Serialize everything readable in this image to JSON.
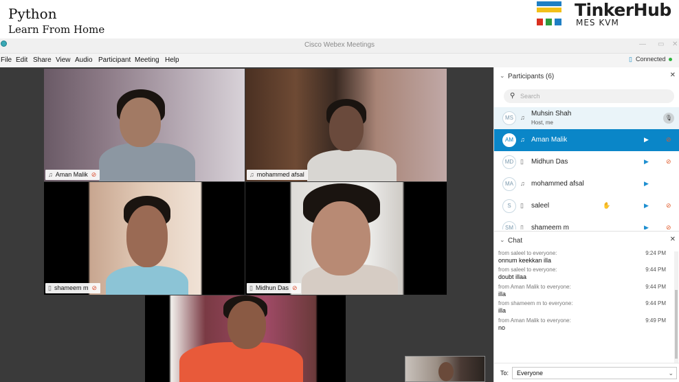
{
  "overlay": {
    "course_title": "Python",
    "course_subtitle": "Learn From Home",
    "brand_name": "TinkerHub",
    "brand_sub": "MES KVM"
  },
  "window": {
    "title": "Cisco Webex Meetings",
    "status": "Connected"
  },
  "menu": [
    "File",
    "Edit",
    "Share",
    "View",
    "Audio",
    "Participant",
    "Meeting",
    "Help"
  ],
  "videos": [
    {
      "name": "Aman Malik",
      "muted": true
    },
    {
      "name": "mohammed afsal",
      "muted": false
    },
    {
      "name": "shameem m",
      "muted": true
    },
    {
      "name": "Midhun Das",
      "muted": true
    }
  ],
  "participants": {
    "header": "Participants (6)",
    "search_placeholder": "Search",
    "list": [
      {
        "initials": "MS",
        "name": "Muhsin Shah",
        "subtitle": "Host, me"
      },
      {
        "initials": "AM",
        "name": "Aman Malik"
      },
      {
        "initials": "MD",
        "name": "Midhun Das"
      },
      {
        "initials": "MA",
        "name": "mohammed afsal"
      },
      {
        "initials": "S",
        "name": "saleel"
      },
      {
        "initials": "SM",
        "name": "shameem m"
      }
    ]
  },
  "chat": {
    "header": "Chat",
    "messages": [
      {
        "from": "from saleel to everyone:",
        "time": "9:24 PM",
        "text": "onnum keekkan illa"
      },
      {
        "from": "from saleel to everyone:",
        "time": "9:44 PM",
        "text": "doubt illaa"
      },
      {
        "from": "from Aman Malik to everyone:",
        "time": "9:44 PM",
        "text": "illa"
      },
      {
        "from": "from shameem m to everyone:",
        "time": "9:44 PM",
        "text": "illa"
      },
      {
        "from": "from Aman Malik to everyone:",
        "time": "9:49 PM",
        "text": "no"
      }
    ],
    "to_label": "To:",
    "to_value": "Everyone"
  }
}
